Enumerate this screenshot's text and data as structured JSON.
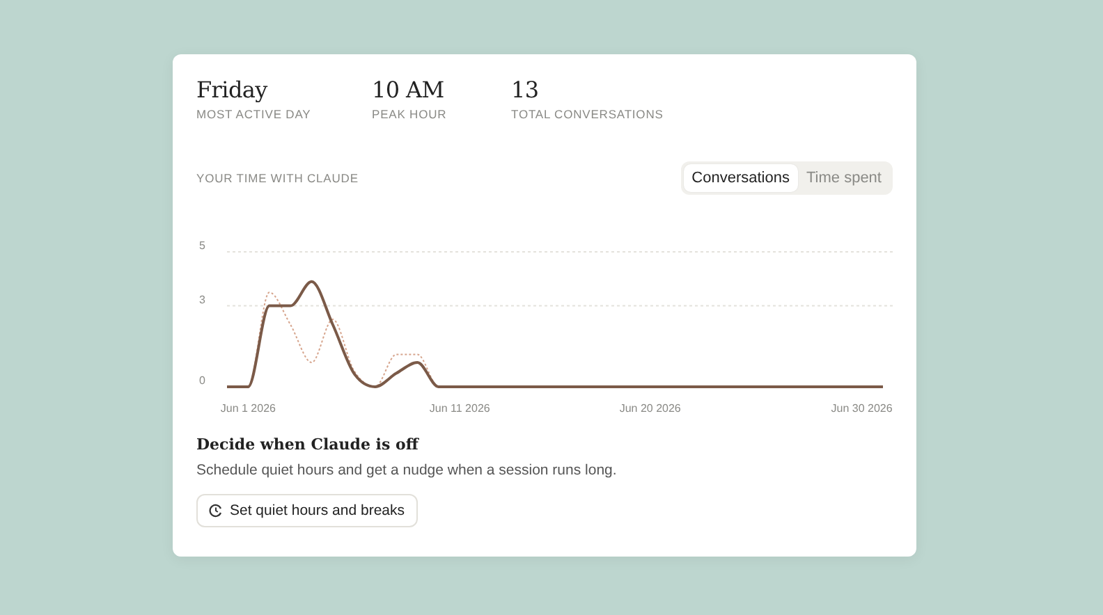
{
  "stats": [
    {
      "value": "Friday",
      "label": "MOST ACTIVE DAY"
    },
    {
      "value": "10 AM",
      "label": "PEAK HOUR"
    },
    {
      "value": "13",
      "label": "TOTAL CONVERSATIONS"
    }
  ],
  "chart_section": {
    "title": "YOUR TIME WITH CLAUDE",
    "toggle": [
      {
        "label": "Conversations",
        "selected": true
      },
      {
        "label": "Time spent",
        "selected": false
      }
    ],
    "chart_data": {
      "type": "line",
      "categories": [
        null,
        "Jun 1 2026",
        null,
        null,
        null,
        null,
        null,
        null,
        null,
        null,
        null,
        "Jun 11 2026",
        null,
        null,
        null,
        null,
        null,
        null,
        null,
        null,
        "Jun 20 2026",
        null,
        null,
        null,
        null,
        null,
        null,
        null,
        null,
        null,
        "Jun 30 2026",
        null
      ],
      "series": [
        {
          "color": "#7b5a48",
          "line_style": "solid",
          "values": [
            0,
            0,
            3,
            3,
            3.9,
            2.3,
            0.5,
            0,
            0.5,
            0.9,
            0,
            0,
            0,
            0,
            0,
            0,
            0,
            0,
            0,
            0,
            0,
            0,
            0,
            0,
            0,
            0,
            0,
            0,
            0,
            0,
            0,
            0
          ]
        },
        {
          "color": "#d6a48c",
          "line_style": "dashed",
          "values": [
            null,
            0,
            3.5,
            2.3,
            0.9,
            2.5,
            0.6,
            0,
            1.2,
            1.2,
            0,
            null,
            null,
            null,
            null,
            null,
            null,
            null,
            null,
            null,
            null,
            null,
            null,
            null,
            null,
            null,
            null,
            null,
            null,
            null,
            null,
            null
          ]
        }
      ],
      "ylim": [
        0,
        5
      ],
      "yticks": [
        0,
        3,
        5
      ]
    }
  },
  "quiet_hours": {
    "heading": "Decide when Claude is off",
    "description": "Schedule quiet hours and get a nudge when a session runs long.",
    "button": "Set quiet hours and breaks"
  }
}
